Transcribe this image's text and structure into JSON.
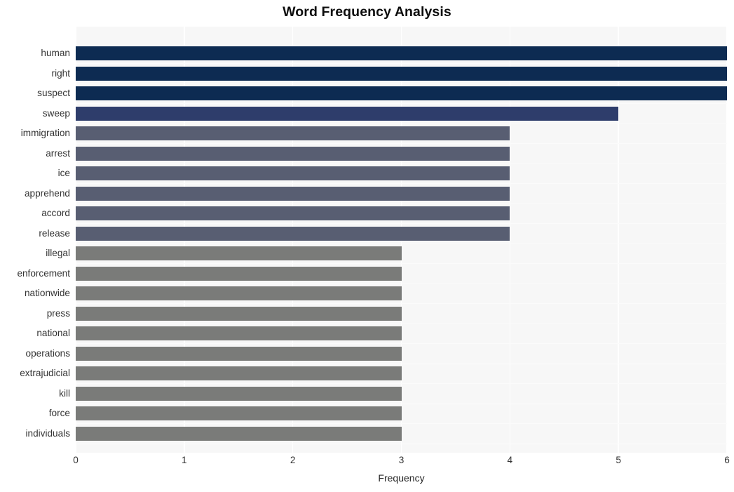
{
  "chart": {
    "title": "Word Frequency Analysis",
    "xlabel": "Frequency",
    "ylabel": ""
  },
  "chart_data": {
    "type": "bar",
    "orientation": "horizontal",
    "title": "Word Frequency Analysis",
    "xlabel": "Frequency",
    "ylabel": "",
    "xlim": [
      0,
      6
    ],
    "xticks": [
      0,
      1,
      2,
      3,
      4,
      5,
      6
    ],
    "xtick_labels": [
      "0",
      "1",
      "2",
      "3",
      "4",
      "5",
      "6"
    ],
    "grid": true,
    "grid_axis": "x",
    "legend": "none",
    "plot_background": "#f7f7f7",
    "categories": [
      "human",
      "right",
      "suspect",
      "sweep",
      "immigration",
      "arrest",
      "ice",
      "apprehend",
      "accord",
      "release",
      "illegal",
      "enforcement",
      "nationwide",
      "press",
      "national",
      "operations",
      "extrajudicial",
      "kill",
      "force",
      "individuals"
    ],
    "values": [
      6,
      6,
      6,
      5,
      4,
      4,
      4,
      4,
      4,
      4,
      3,
      3,
      3,
      3,
      3,
      3,
      3,
      3,
      3,
      3
    ],
    "bar_colors": [
      "#0d2b52",
      "#0d2b52",
      "#0d2b52",
      "#2e3d6b",
      "#585e72",
      "#585e72",
      "#585e72",
      "#585e72",
      "#585e72",
      "#585e72",
      "#7a7b79",
      "#7a7b79",
      "#7a7b79",
      "#7a7b79",
      "#7a7b79",
      "#7a7b79",
      "#7a7b79",
      "#7a7b79",
      "#7a7b79",
      "#7a7b79"
    ],
    "colors": {
      "dark_navy": "#0d2b52",
      "medium_navy": "#2e3d6b",
      "slate": "#585e72",
      "gray": "#7a7b79",
      "gridline": "#ffffff",
      "plot_bg": "#f7f7f7",
      "title": "#0d0d0d",
      "tick_text": "#333333"
    }
  }
}
